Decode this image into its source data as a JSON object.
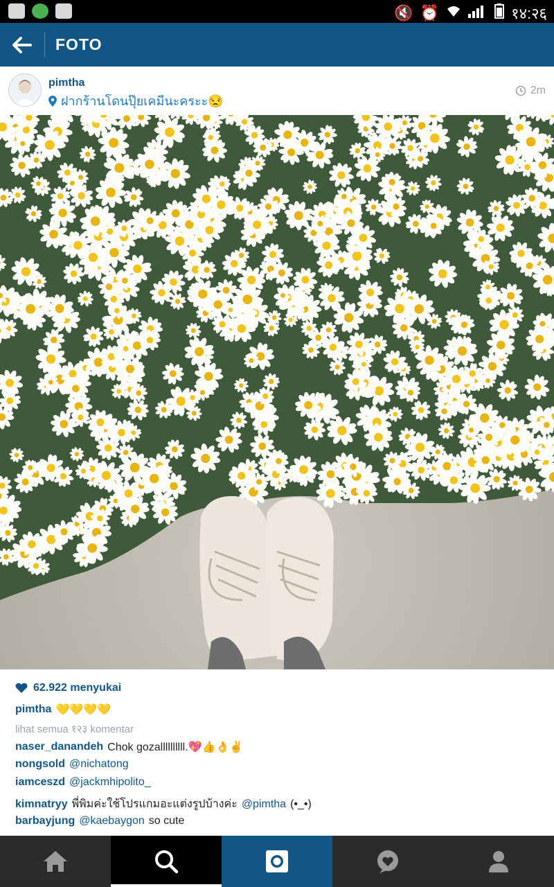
{
  "status_bar": {
    "time": "१४:२६"
  },
  "app_bar": {
    "title": "FOTO"
  },
  "post": {
    "username": "pimtha",
    "location": "ฝากร้านโดนปุ๊ยเคมีนะคระะ😒",
    "time_ago": "2m",
    "likes": "62.922 menyukai",
    "caption_user": "pimtha",
    "caption_emoji": "💛💛💛💛",
    "view_all_comments": "lihat semua १२३ komentar"
  },
  "comments": [
    {
      "user": "naser_danandeh",
      "text": "Chok gozallllllllll.💖👍👌✌",
      "mention": ""
    },
    {
      "user": "nongsold",
      "text": "",
      "mention": "@nichatong"
    },
    {
      "user": "iamceszd",
      "text": "",
      "mention": "@jackmhipolito_"
    },
    {
      "user": "kimnatryy",
      "text": "พี่พิมค่ะใช้โปรแกมอะแต่งรูปบ้างค่ะ",
      "mention": "@pimtha",
      "suffix": "(•_•)"
    },
    {
      "user": "barbayjung",
      "text": "so cute",
      "mention": "@kaebaygon"
    }
  ],
  "nav_tabs": [
    {
      "name": "home",
      "icon": "home-icon"
    },
    {
      "name": "explore",
      "icon": "search-icon"
    },
    {
      "name": "camera",
      "icon": "camera-icon"
    },
    {
      "name": "activity",
      "icon": "heart-bubble-icon"
    },
    {
      "name": "profile",
      "icon": "profile-icon"
    }
  ],
  "colors": {
    "brand": "#125688",
    "link": "#1e7bbf",
    "muted": "#9aa5ad"
  }
}
